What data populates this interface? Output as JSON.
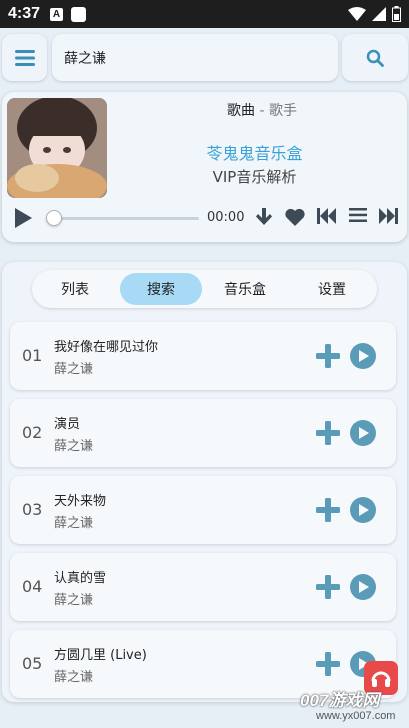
{
  "status_bar": {
    "time": "4:37",
    "notification_letter": "A"
  },
  "search": {
    "value": "薛之谦"
  },
  "player": {
    "song_label": "歌曲",
    "separator": " - ",
    "singer_label": "歌手",
    "app_title": "苓鬼鬼音乐盒",
    "app_subtitle": "VIP音乐解析",
    "time": "00:00",
    "progress": 0
  },
  "tabs": [
    {
      "label": "列表",
      "active": false
    },
    {
      "label": "搜索",
      "active": true
    },
    {
      "label": "音乐盒",
      "active": false
    },
    {
      "label": "设置",
      "active": false
    }
  ],
  "songs": [
    {
      "num": "01",
      "title": "我好像在哪见过你",
      "artist": "薛之谦"
    },
    {
      "num": "02",
      "title": "演员",
      "artist": "薛之谦"
    },
    {
      "num": "03",
      "title": "天外来物",
      "artist": "薛之谦"
    },
    {
      "num": "04",
      "title": "认真的雪",
      "artist": "薛之谦"
    },
    {
      "num": "05",
      "title": "方圆几里 (Live)",
      "artist": "薛之谦"
    }
  ],
  "watermark": {
    "text": "007游戏网",
    "url": "www.yx007.com"
  },
  "colors": {
    "accent": "#3aa0d8",
    "tab_active": "#a9daf5",
    "icon": "#5a9bb8",
    "watermark": "#e84a4a"
  }
}
